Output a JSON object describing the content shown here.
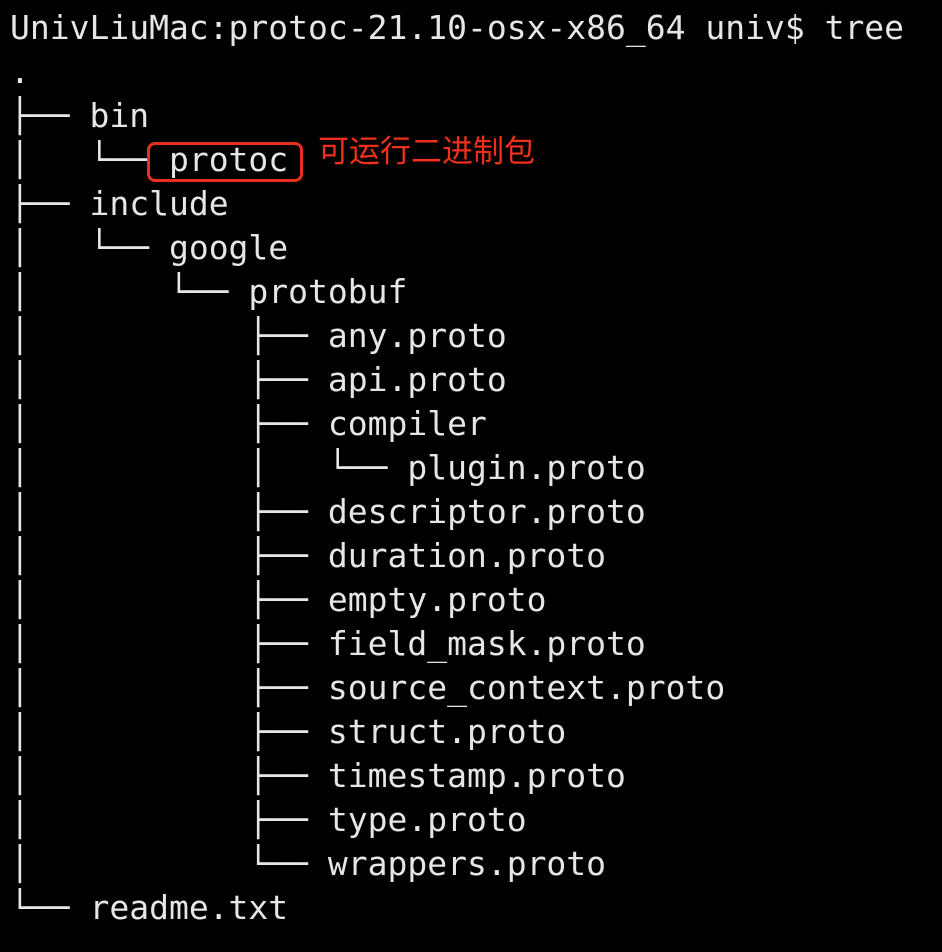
{
  "prompt_line": "UnivLiuMac:protoc-21.10-osx-x86_64 univ$ tree",
  "root": ".",
  "tree": [
    {
      "branch": "├── ",
      "name": "bin"
    },
    {
      "branch": "│   └── ",
      "name": "protoc"
    },
    {
      "branch": "├── ",
      "name": "include"
    },
    {
      "branch": "│   └── ",
      "name": "google"
    },
    {
      "branch": "│       └── ",
      "name": "protobuf"
    },
    {
      "branch": "│           ├── ",
      "name": "any.proto"
    },
    {
      "branch": "│           ├── ",
      "name": "api.proto"
    },
    {
      "branch": "│           ├── ",
      "name": "compiler"
    },
    {
      "branch": "│           │   └── ",
      "name": "plugin.proto"
    },
    {
      "branch": "│           ├── ",
      "name": "descriptor.proto"
    },
    {
      "branch": "│           ├── ",
      "name": "duration.proto"
    },
    {
      "branch": "│           ├── ",
      "name": "empty.proto"
    },
    {
      "branch": "│           ├── ",
      "name": "field_mask.proto"
    },
    {
      "branch": "│           ├── ",
      "name": "source_context.proto"
    },
    {
      "branch": "│           ├── ",
      "name": "struct.proto"
    },
    {
      "branch": "│           ├── ",
      "name": "timestamp.proto"
    },
    {
      "branch": "│           ├── ",
      "name": "type.proto"
    },
    {
      "branch": "│           └── ",
      "name": "wrappers.proto"
    },
    {
      "branch": "└── ",
      "name": "readme.txt"
    }
  ],
  "annotation": {
    "text": "可运行二进制包",
    "color": "#f0301c"
  },
  "colors": {
    "background": "#000000",
    "text": "#e6e6e6",
    "highlight": "#e8301e"
  }
}
